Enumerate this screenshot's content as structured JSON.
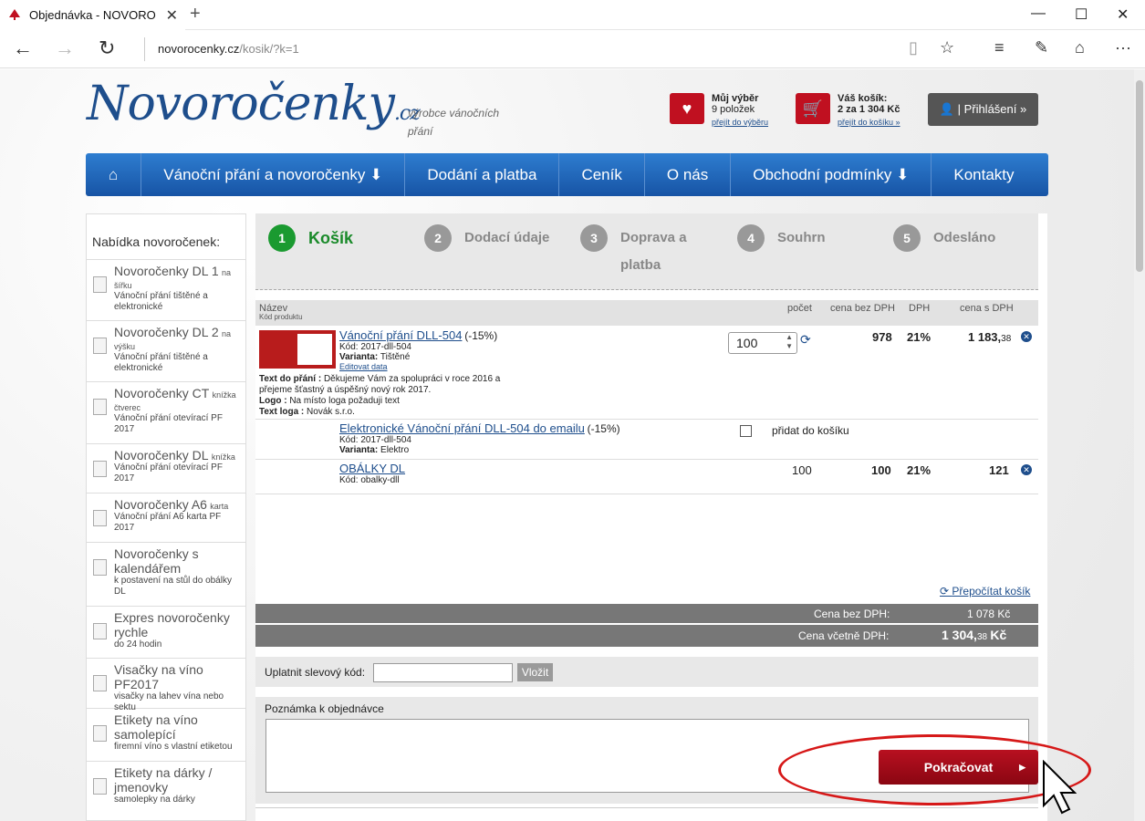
{
  "browser": {
    "tab_title": "Objednávka - NOVORO",
    "url_domain": "novorocenky.cz",
    "url_path": "/kosik/?k=1"
  },
  "header": {
    "logo": "Novoročenky",
    "logo_tld": ".cz",
    "tagline": "výrobce vánočních přání",
    "my_selection": {
      "title": "Můj výběr",
      "count": "9 položek",
      "link": "přejít do výběru"
    },
    "cart": {
      "title": "Váš košík:",
      "summary": "2 za 1 304 Kč",
      "link": "přejít do košíku »"
    },
    "login": "Přihlášení »"
  },
  "menu": [
    "Vánoční přání a novoročenky",
    "Dodání a platba",
    "Ceník",
    "O nás",
    "Obchodní podmínky",
    "Kontakty"
  ],
  "sidebar": {
    "title": "Nabídka novoročenek:",
    "items": [
      {
        "name": "Novoročenky DL 1",
        "small": "na šířku",
        "desc": "Vánoční přání tištěné a elektronické"
      },
      {
        "name": "Novoročenky DL 2",
        "small": "na výšku",
        "desc": "Vánoční přání tištěné a elektronické"
      },
      {
        "name": "Novoročenky CT",
        "small": "knížka čtverec",
        "desc": "Vánoční přání otevírací PF 2017"
      },
      {
        "name": "Novoročenky DL",
        "small": "knížka",
        "desc": "Vánoční přání otevírací PF 2017"
      },
      {
        "name": "Novoročenky A6",
        "small": "karta",
        "desc": "Vánoční přání A6 karta PF 2017"
      },
      {
        "name": "Novoročenky s kalendářem",
        "small": "",
        "desc": "k postavení na stůl do obálky DL"
      },
      {
        "name": "Expres novoročenky rychle",
        "small": "",
        "desc": "do 24 hodin"
      },
      {
        "name": "Visačky na víno PF2017",
        "small": "",
        "desc": "visačky na lahev vína nebo sektu"
      },
      {
        "name": "Etikety na víno samolepící",
        "small": "",
        "desc": "firemní víno s vlastní etiketou"
      },
      {
        "name": "Etikety na dárky / jmenovky",
        "small": "",
        "desc": "samolepky na dárky"
      }
    ]
  },
  "steps": [
    {
      "num": "1",
      "label": "Košík"
    },
    {
      "num": "2",
      "label": "Dodací údaje"
    },
    {
      "num": "3",
      "label": "Doprava a platba"
    },
    {
      "num": "4",
      "label": "Souhrn"
    },
    {
      "num": "5",
      "label": "Odesláno"
    }
  ],
  "table": {
    "col_name": "Název",
    "col_code": "Kód produktu",
    "col_qty": "počet",
    "col_price": "cena bez DPH",
    "col_vat": "DPH",
    "col_total": "cena s DPH"
  },
  "items": [
    {
      "title": "Vánoční přání DLL-504",
      "discount": "(-15%)",
      "code": "Kód: 2017-dll-504",
      "variant_label": "Varianta:",
      "variant": "Tištěné",
      "edit": "Editovat data",
      "text_label": "Text do přání :",
      "text": "Děkujeme Vám za spolupráci v roce 2016 a přejeme šťastný a úspěšný nový rok 2017.",
      "logo_label": "Logo :",
      "logo": "Na místo loga požaduji text",
      "logotext_label": "Text loga :",
      "logotext": "Novák s.r.o.",
      "qty": "100",
      "price": "978",
      "vat": "21%",
      "total_main": "1 183,",
      "total_dec": "38"
    },
    {
      "title": "Elektronické Vánoční přání DLL-504 do emailu",
      "discount": "(-15%)",
      "code": "Kód: 2017-dll-504",
      "variant_label": "Varianta:",
      "variant": "Elektro",
      "add": "přidat do košíku"
    },
    {
      "title": "OBÁLKY DL",
      "code": "Kód: obalky-dll",
      "qty": "100",
      "price": "100",
      "vat": "21%",
      "total": "121"
    }
  ],
  "recalc": "Přepočítat košík",
  "totals": {
    "net_label": "Cena bez DPH:",
    "net": "1 078 Kč",
    "gross_label": "Cena včetně DPH:",
    "gross_main": "1 304,",
    "gross_dec": "38",
    "gross_cur": "Kč"
  },
  "coupon": {
    "label": "Uplatnit slevový kód:",
    "button": "Vložit"
  },
  "note": {
    "label": "Poznámka k objednávce"
  },
  "continue": "Pokračovat"
}
